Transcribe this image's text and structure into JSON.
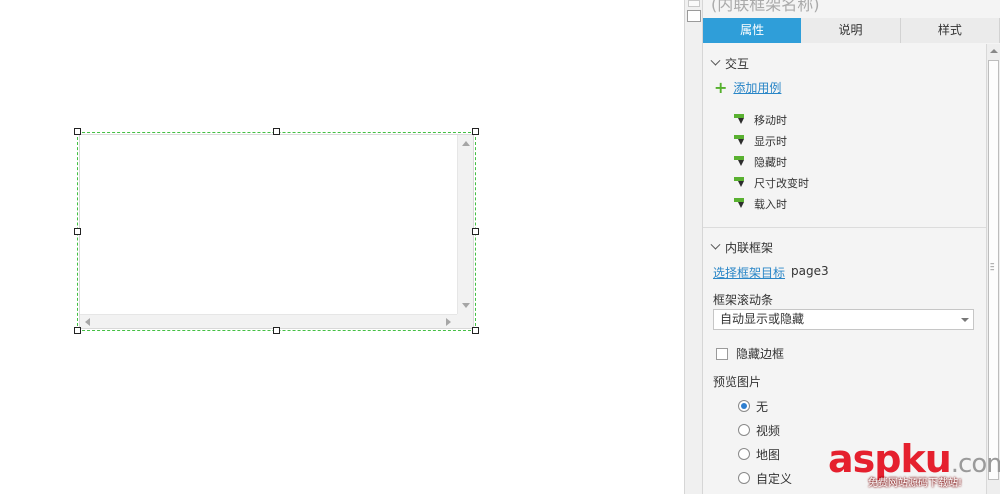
{
  "panel": {
    "title": "(内联框架名称)",
    "tabs": [
      {
        "label": "属性",
        "active": true
      },
      {
        "label": "说明",
        "active": false
      },
      {
        "label": "样式",
        "active": false
      }
    ],
    "interaction": {
      "section_label": "交互",
      "add_case_label": "添加用例",
      "events": [
        "移动时",
        "显示时",
        "隐藏时",
        "尺寸改变时",
        "载入时"
      ]
    },
    "inline_frame": {
      "section_label": "内联框架",
      "select_target_link": "选择框架目标",
      "target_value": "page3",
      "scrollbar_label": "框架滚动条",
      "scrollbar_value": "自动显示或隐藏",
      "hide_border_label": "隐藏边框",
      "hide_border_checked": false,
      "preview_label": "预览图片",
      "preview_options": [
        {
          "label": "无",
          "checked": true
        },
        {
          "label": "视频",
          "checked": false
        },
        {
          "label": "地图",
          "checked": false
        },
        {
          "label": "自定义",
          "checked": false
        }
      ]
    }
  },
  "watermark": {
    "logo_main": "aspku",
    "logo_suffix": ".com",
    "tagline": "免费网站源码下载站!"
  },
  "colors": {
    "accent": "#2f9ed9",
    "selection": "#44c044",
    "link": "#2a86c7",
    "flag": "#59b130",
    "watermark_red": "#e5202e"
  }
}
